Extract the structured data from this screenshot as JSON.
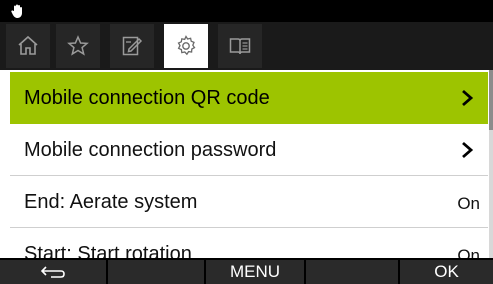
{
  "status_bar": {
    "icon": "hand-icon"
  },
  "tabs": [
    {
      "icon": "home-icon",
      "active": false
    },
    {
      "icon": "star-icon",
      "active": false
    },
    {
      "icon": "edit-icon",
      "active": false
    },
    {
      "icon": "gear-icon",
      "active": true
    },
    {
      "icon": "book-icon",
      "active": false
    }
  ],
  "list": {
    "items": [
      {
        "label": "Mobile connection QR code",
        "selected": true,
        "trailing": "chevron-right-icon"
      },
      {
        "label": "Mobile connection password",
        "selected": false,
        "trailing": "chevron-right-icon"
      },
      {
        "label": "End: Aerate system",
        "value": "On"
      },
      {
        "label": "Start: Start rotation",
        "value": "On"
      }
    ]
  },
  "softkeys": {
    "back_icon": "back-arrow-icon",
    "key2": "",
    "menu": "MENU",
    "key4": "",
    "ok": "OK"
  },
  "colors": {
    "accent": "#9dc400",
    "bar": "#000000"
  }
}
